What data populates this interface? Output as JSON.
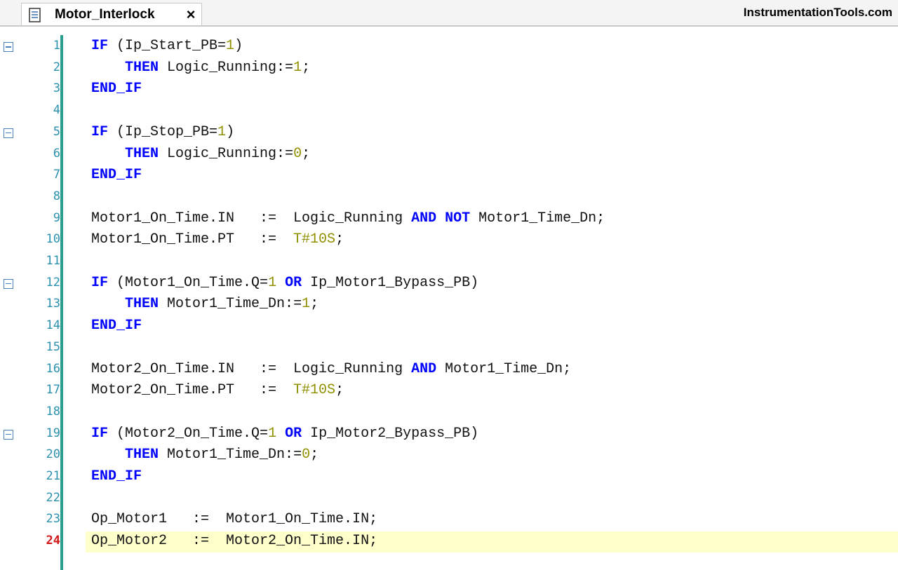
{
  "tab": {
    "title": "Motor_Interlock",
    "close": "×",
    "icon": "document-icon"
  },
  "brand": "InstrumentationTools.com",
  "editor": {
    "active_line": 24,
    "lines": [
      {
        "n": "1",
        "fold": true,
        "tokens": [
          [
            "kw",
            "IF"
          ],
          [
            "t",
            " (Ip_Start_PB="
          ],
          [
            "num",
            "1"
          ],
          [
            "t",
            ")"
          ]
        ]
      },
      {
        "n": "2",
        "fold": false,
        "tokens": [
          [
            "t",
            "    "
          ],
          [
            "kw",
            "THEN"
          ],
          [
            "t",
            " Logic_Running:="
          ],
          [
            "num",
            "1"
          ],
          [
            "t",
            ";"
          ]
        ]
      },
      {
        "n": "3",
        "fold": false,
        "tokens": [
          [
            "kw",
            "END_IF"
          ]
        ]
      },
      {
        "n": "4",
        "fold": false,
        "tokens": []
      },
      {
        "n": "5",
        "fold": true,
        "tokens": [
          [
            "kw",
            "IF"
          ],
          [
            "t",
            " (Ip_Stop_PB="
          ],
          [
            "num",
            "1"
          ],
          [
            "t",
            ")"
          ]
        ]
      },
      {
        "n": "6",
        "fold": false,
        "tokens": [
          [
            "t",
            "    "
          ],
          [
            "kw",
            "THEN"
          ],
          [
            "t",
            " Logic_Running:="
          ],
          [
            "num",
            "0"
          ],
          [
            "t",
            ";"
          ]
        ]
      },
      {
        "n": "7",
        "fold": false,
        "tokens": [
          [
            "kw",
            "END_IF"
          ]
        ]
      },
      {
        "n": "8",
        "fold": false,
        "tokens": []
      },
      {
        "n": "9",
        "fold": false,
        "tokens": [
          [
            "t",
            "Motor1_On_Time.IN   :=  Logic_Running "
          ],
          [
            "kw",
            "AND NOT"
          ],
          [
            "t",
            " Motor1_Time_Dn;"
          ]
        ]
      },
      {
        "n": "10",
        "fold": false,
        "tokens": [
          [
            "t",
            "Motor1_On_Time.PT   :=  "
          ],
          [
            "str",
            "T#10S"
          ],
          [
            "t",
            ";"
          ]
        ]
      },
      {
        "n": "11",
        "fold": false,
        "tokens": []
      },
      {
        "n": "12",
        "fold": true,
        "tokens": [
          [
            "kw",
            "IF"
          ],
          [
            "t",
            " (Motor1_On_Time.Q="
          ],
          [
            "num",
            "1"
          ],
          [
            "t",
            " "
          ],
          [
            "kw",
            "OR"
          ],
          [
            "t",
            " Ip_Motor1_Bypass_PB)"
          ]
        ]
      },
      {
        "n": "13",
        "fold": false,
        "tokens": [
          [
            "t",
            "    "
          ],
          [
            "kw",
            "THEN"
          ],
          [
            "t",
            " Motor1_Time_Dn:="
          ],
          [
            "num",
            "1"
          ],
          [
            "t",
            ";"
          ]
        ]
      },
      {
        "n": "14",
        "fold": false,
        "tokens": [
          [
            "kw",
            "END_IF"
          ]
        ]
      },
      {
        "n": "15",
        "fold": false,
        "tokens": []
      },
      {
        "n": "16",
        "fold": false,
        "tokens": [
          [
            "t",
            "Motor2_On_Time.IN   :=  Logic_Running "
          ],
          [
            "kw",
            "AND"
          ],
          [
            "t",
            " Motor1_Time_Dn;"
          ]
        ]
      },
      {
        "n": "17",
        "fold": false,
        "tokens": [
          [
            "t",
            "Motor2_On_Time.PT   :=  "
          ],
          [
            "str",
            "T#10S"
          ],
          [
            "t",
            ";"
          ]
        ]
      },
      {
        "n": "18",
        "fold": false,
        "tokens": []
      },
      {
        "n": "19",
        "fold": true,
        "tokens": [
          [
            "kw",
            "IF"
          ],
          [
            "t",
            " (Motor2_On_Time.Q="
          ],
          [
            "num",
            "1"
          ],
          [
            "t",
            " "
          ],
          [
            "kw",
            "OR"
          ],
          [
            "t",
            " Ip_Motor2_Bypass_PB)"
          ]
        ]
      },
      {
        "n": "20",
        "fold": false,
        "tokens": [
          [
            "t",
            "    "
          ],
          [
            "kw",
            "THEN"
          ],
          [
            "t",
            " Motor1_Time_Dn:="
          ],
          [
            "num",
            "0"
          ],
          [
            "t",
            ";"
          ]
        ]
      },
      {
        "n": "21",
        "fold": false,
        "tokens": [
          [
            "kw",
            "END_IF"
          ]
        ]
      },
      {
        "n": "22",
        "fold": false,
        "tokens": []
      },
      {
        "n": "23",
        "fold": false,
        "tokens": [
          [
            "t",
            "Op_Motor1   :=  Motor1_On_Time.IN;"
          ]
        ]
      },
      {
        "n": "24",
        "fold": false,
        "tokens": [
          [
            "t",
            "Op_Motor2   :=  Motor2_On_Time.IN;"
          ]
        ]
      }
    ]
  }
}
